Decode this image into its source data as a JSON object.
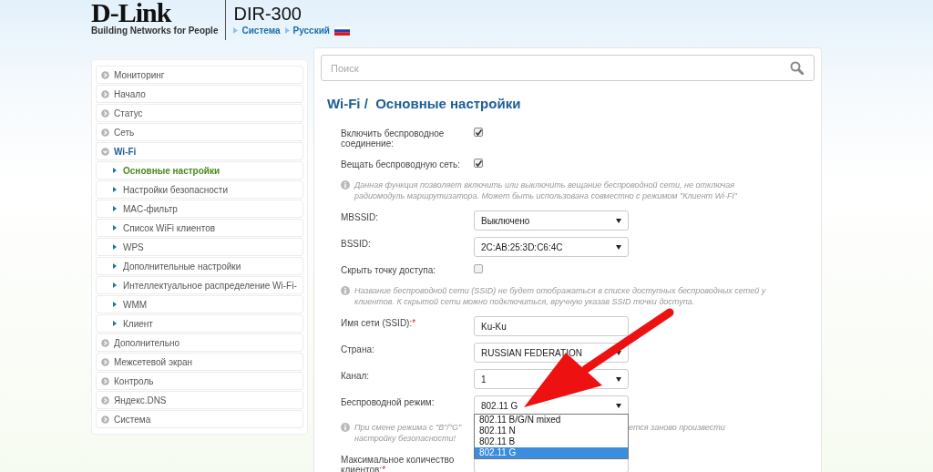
{
  "header": {
    "logo": "D-Link",
    "tagline": "Building Networks for People",
    "model": "DIR-300",
    "breadcrumbs": [
      "Система",
      "Русский"
    ]
  },
  "search": {
    "placeholder": "Поиск"
  },
  "sidebar": {
    "items": [
      {
        "label": "Мониторинг",
        "expanded": false
      },
      {
        "label": "Начало",
        "expanded": false
      },
      {
        "label": "Статус",
        "expanded": false
      },
      {
        "label": "Сеть",
        "expanded": false
      },
      {
        "label": "Wi-Fi",
        "expanded": true,
        "children": [
          {
            "label": "Основные настройки",
            "selected": true
          },
          {
            "label": "Настройки безопасности",
            "selected": false
          },
          {
            "label": "MAC-фильтр",
            "selected": false
          },
          {
            "label": "Список WiFi клиентов",
            "selected": false
          },
          {
            "label": "WPS",
            "selected": false
          },
          {
            "label": "Дополнительные настройки",
            "selected": false
          },
          {
            "label": "Интеллектуальное распределение Wi-Fi-",
            "selected": false
          },
          {
            "label": "WMM",
            "selected": false
          },
          {
            "label": "Клиент",
            "selected": false
          }
        ]
      },
      {
        "label": "Дополнительно",
        "expanded": false
      },
      {
        "label": "Межсетевой экран",
        "expanded": false
      },
      {
        "label": "Контроль",
        "expanded": false
      },
      {
        "label": "Яндекс.DNS",
        "expanded": false
      },
      {
        "label": "Система",
        "expanded": false
      }
    ]
  },
  "title": "Wi-Fi /  Основные настройки",
  "form": {
    "rows": [
      {
        "kind": "checkbox",
        "label": "Включить беспроводное соединение:",
        "checked": true
      },
      {
        "kind": "checkbox",
        "label": "Вещать беспроводную сеть:",
        "checked": true
      },
      {
        "kind": "hint",
        "parts": [
          "Данная функция позволяет включить или выключить вещание беспроводной сети, не отключая радиомодуль маршрутизатора. Может быть использована совместно с режимом \"Клиент Wi-Fi\""
        ]
      },
      {
        "kind": "select",
        "label": "MBSSID:",
        "value": "Выключено"
      },
      {
        "kind": "select",
        "label": "BSSID:",
        "value": "2C:AB:25:3D:C6:4C"
      },
      {
        "kind": "checkbox",
        "label": "Скрыть точку доступа:",
        "checked": false
      },
      {
        "kind": "hint",
        "parts": [
          "Название беспроводной сети (SSID) не будет отображаться в списке доступных беспроводных сетей у клиентов. К скрытой сети можно подключиться, вручную указав SSID точки доступа."
        ]
      },
      {
        "kind": "text",
        "label": "Имя сети (SSID):",
        "required_mark": "*",
        "value": "Ku-Ku"
      },
      {
        "kind": "select",
        "label": "Страна:",
        "value": "RUSSIAN FEDERATION"
      },
      {
        "kind": "select",
        "label": "Канал:",
        "value": "1"
      },
      {
        "kind": "select",
        "label": "Беспроводной режим:",
        "value": "802.11 G",
        "options": [
          {
            "label": "802.11 B/G/N mixed",
            "selected": false
          },
          {
            "label": "802.11 N",
            "selected": false
          },
          {
            "label": "802.11 B",
            "selected": false
          },
          {
            "label": "802.11 G",
            "selected": true
          }
        ]
      },
      {
        "kind": "hint",
        "parts": [
          "При смене режима с \"B\"/\"G\"",
          "ется заново произвести",
          "настройку безопасности!"
        ]
      },
      {
        "kind": "text",
        "label": "Максимальное количество клиентов:",
        "required_mark": "*"
      }
    ]
  }
}
